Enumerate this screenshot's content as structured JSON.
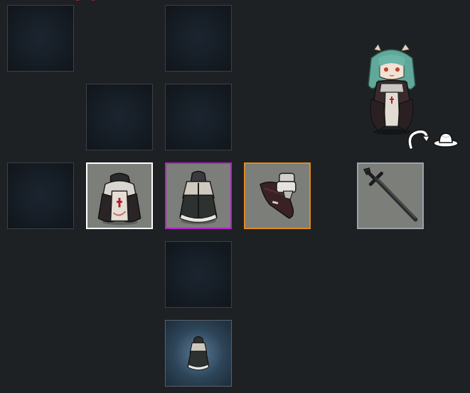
{
  "screen": "equipment-slots",
  "colors": {
    "background": "#1e2124",
    "empty_slot": "#141a21",
    "filled_slot": "#7c7e79",
    "border_common": "#ffffff",
    "border_epic": "#b023c8",
    "border_legendary": "#e08a1e",
    "border_weapon": "#9aa3aa",
    "selected_slot": "#2d4458"
  },
  "character": {
    "icon": "chibi-character-portrait",
    "hair_color": "#5fa89a"
  },
  "actions": {
    "rotate_icon": "rotate-arrow-icon",
    "hat_icon": "hat-toggle-icon"
  },
  "slots": [
    {
      "id": "slot-r1c1",
      "state": "empty"
    },
    {
      "id": "slot-r1c3",
      "state": "empty"
    },
    {
      "id": "slot-r2c2",
      "state": "empty"
    },
    {
      "id": "slot-r2c3",
      "state": "empty"
    },
    {
      "id": "slot-r3c1",
      "state": "empty"
    },
    {
      "id": "slot-r3c2",
      "state": "equipped",
      "item_icon": "knight-tabard-armor-icon",
      "rarity_color": "#ffffff"
    },
    {
      "id": "slot-r3c3",
      "state": "equipped",
      "item_icon": "dark-robe-armor-icon",
      "rarity_color": "#b023c8"
    },
    {
      "id": "slot-r3c4",
      "state": "equipped",
      "item_icon": "gauntlet-cape-icon",
      "rarity_color": "#e08a1e"
    },
    {
      "id": "slot-r3c5",
      "state": "equipped",
      "item_icon": "longsword-icon",
      "rarity_color": "#9aa3aa"
    },
    {
      "id": "slot-r4c3",
      "state": "empty"
    },
    {
      "id": "slot-r5c3",
      "state": "selected",
      "item_icon": "small-robe-icon"
    }
  ]
}
